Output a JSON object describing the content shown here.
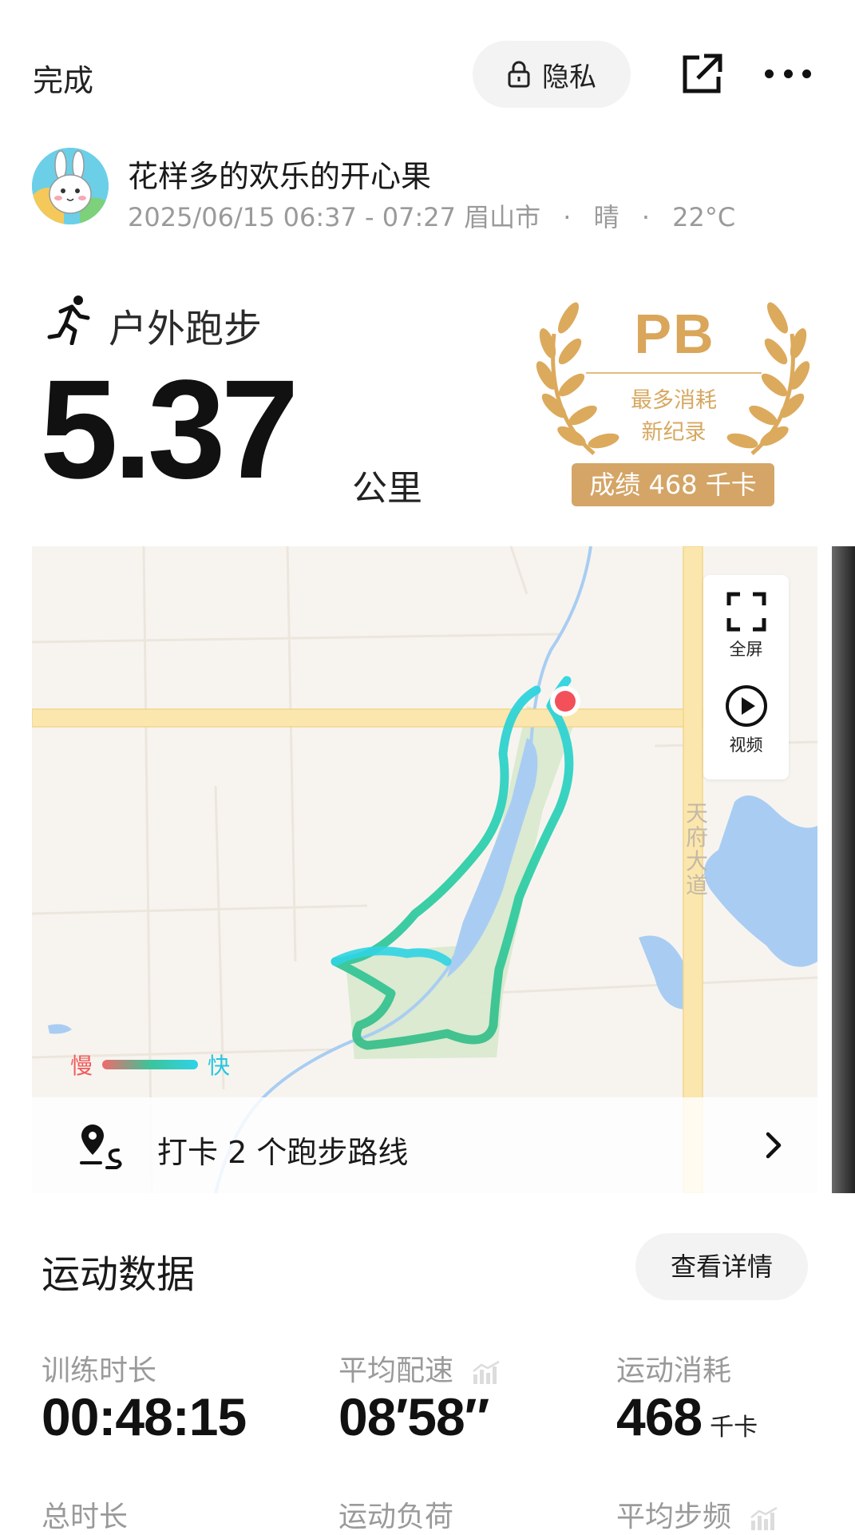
{
  "topbar": {
    "done_label": "完成",
    "privacy_label": "隐私",
    "share_icon": "share-external-icon",
    "more_icon": "more-dots-icon"
  },
  "user": {
    "name": "花样多的欢乐的开心果",
    "time_range": "2025/06/15 06:37 - 07:27",
    "city": "眉山市",
    "weather": "晴",
    "temperature": "22°C",
    "separator": "·"
  },
  "workout": {
    "type_label": "户外跑步",
    "distance": "5.37",
    "distance_unit": "公里"
  },
  "pb_badge": {
    "title": "PB",
    "line1": "最多消耗",
    "line2": "新纪录",
    "score": "成绩 468 千卡",
    "accent_color": "#d4a566"
  },
  "map": {
    "fullscreen_label": "全屏",
    "video_label": "视频",
    "legend_slow": "慢",
    "legend_fast": "快",
    "road_label": "天府大道",
    "checkin_text": "打卡 2 个跑步路线"
  },
  "stats": {
    "section_title": "运动数据",
    "detail_button": "查看详情",
    "items": [
      {
        "label": "训练时长",
        "value": "00:48:15",
        "unit": ""
      },
      {
        "label": "平均配速",
        "value": "08′58″",
        "unit": ""
      },
      {
        "label": "运动消耗",
        "value": "468",
        "unit": "千卡"
      }
    ],
    "items_row2": [
      {
        "label": "总时长"
      },
      {
        "label": "运动负荷"
      },
      {
        "label": "平均步频"
      }
    ]
  }
}
